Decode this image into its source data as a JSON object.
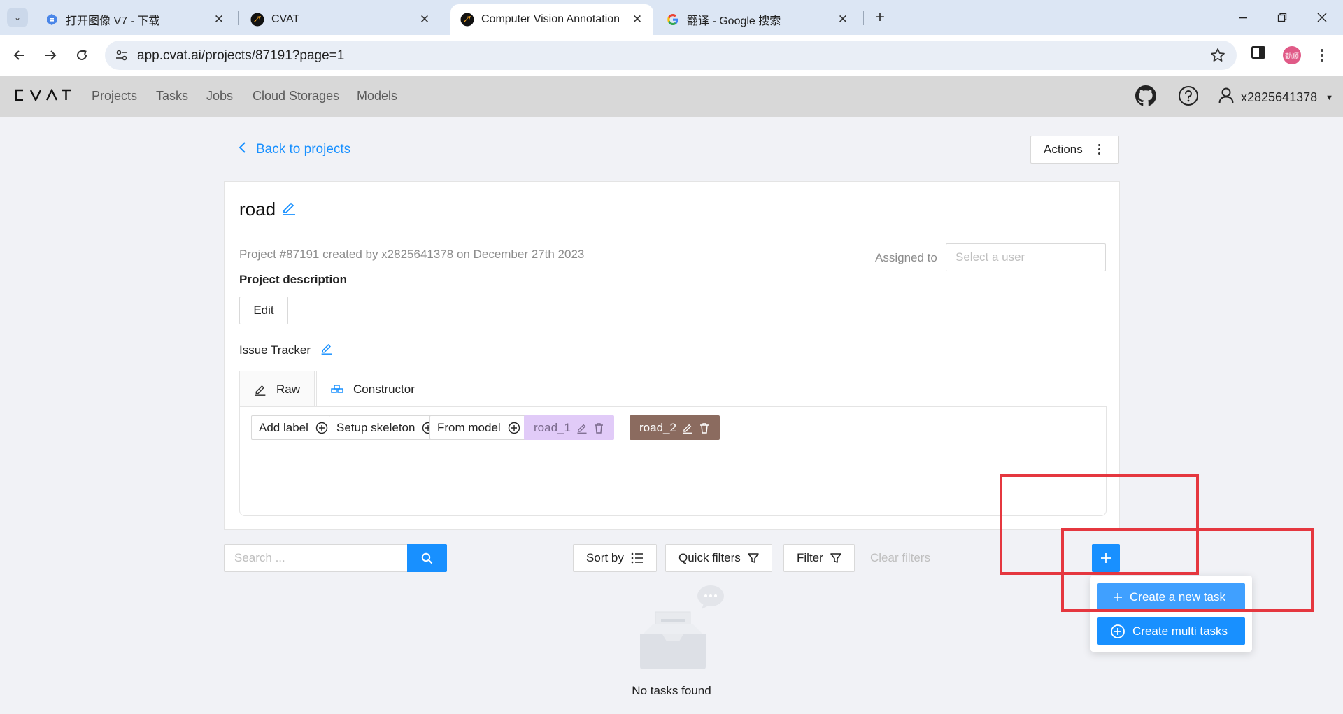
{
  "browser": {
    "tabs": [
      {
        "title": "打开图像 V7 - 下载",
        "active": false
      },
      {
        "title": "CVAT",
        "active": false
      },
      {
        "title": "Computer Vision Annotation",
        "active": true
      },
      {
        "title": "翻译 - Google 搜索",
        "active": false
      }
    ],
    "url": "app.cvat.ai/projects/87191?page=1",
    "profile_label": "勤顺"
  },
  "header": {
    "logo": "CVAT",
    "nav": [
      "Projects",
      "Tasks",
      "Jobs",
      "Cloud Storages",
      "Models"
    ],
    "username": "x2825641378"
  },
  "page": {
    "back_link": "Back to projects",
    "actions_label": "Actions",
    "project": {
      "name": "road",
      "meta": "Project #87191 created by x2825641378 on December 27th 2023",
      "assigned_label": "Assigned to",
      "assigned_placeholder": "Select a user",
      "description_label": "Project description",
      "edit_label": "Edit",
      "issue_tracker_label": "Issue Tracker"
    },
    "label_tabs": [
      {
        "label": "Raw"
      },
      {
        "label": "Constructor"
      }
    ],
    "constructor": {
      "add_label": "Add label",
      "setup_skeleton": "Setup skeleton",
      "from_model": "From model",
      "labels": [
        {
          "name": "road_1",
          "color": "#e1cbf8",
          "text_color": "#7a6a8c"
        },
        {
          "name": "road_2",
          "color": "#8b6b5f",
          "text_color": "#ffffff"
        }
      ]
    },
    "tasks_toolbar": {
      "search_placeholder": "Search ...",
      "sort_by": "Sort by",
      "quick_filters": "Quick filters",
      "filter": "Filter",
      "clear_filters": "Clear filters"
    },
    "create_menu": {
      "new_task": "Create a new task",
      "multi_tasks": "Create multi tasks"
    },
    "empty_text": "No tasks found"
  },
  "colors": {
    "accent": "#1890ff",
    "highlight": "#e5373f"
  }
}
